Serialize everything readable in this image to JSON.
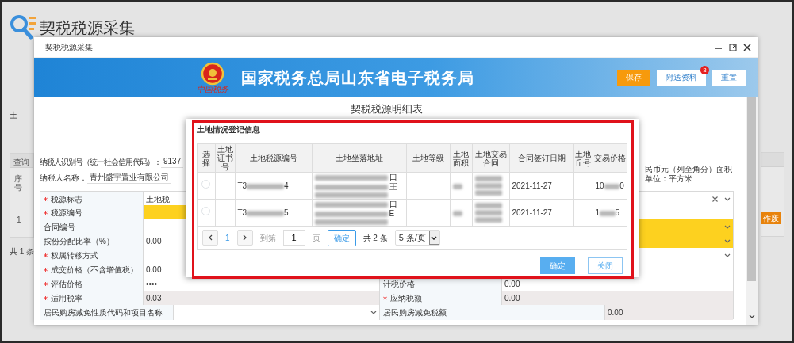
{
  "page": {
    "title": "契税税源采集",
    "left_label": "土",
    "results_title": "查询",
    "results_header": "序号",
    "results_row": "1",
    "total": "共 1 条",
    "void_button": "作废"
  },
  "window": {
    "title": "契税税源采集",
    "banner_title": "国家税务总局山东省电子税务局",
    "logo_caption": "中国税务",
    "buttons": [
      {
        "label": "保存",
        "kind": "primary"
      },
      {
        "label": "附送资料",
        "kind": "plain",
        "badge": "3"
      },
      {
        "label": "重置",
        "kind": "plain"
      }
    ]
  },
  "form": {
    "title": "契税税源明细表",
    "taxpayer_id_label": "纳税人识别号（统一社会信用代码）：",
    "taxpayer_id": "9137",
    "taxpayer_name_label": "纳税人名称：",
    "taxpayer_name": "青州盛宇置业有限公司",
    "units_note": "民币元（列至角分）面积单位：平方米",
    "rows": [
      {
        "kind": "full",
        "label": "税源标志",
        "required": true,
        "field": {
          "value": "土地税",
          "kind": "select",
          "clearable": true,
          "highlighted": false,
          "readonly": false
        }
      },
      {
        "kind": "split",
        "label": "税源编号",
        "required": true,
        "field": {
          "kind": "text",
          "highlighted": true,
          "readonly": false
        },
        "field2": {
          "kind": "text",
          "highlighted": false,
          "readonly": false
        }
      },
      {
        "kind": "split",
        "label": "合同编号",
        "required": false,
        "field": {
          "kind": "text",
          "highlighted": false,
          "readonly": false
        },
        "field2": {
          "kind": "select",
          "highlighted": true,
          "readonly": false
        }
      },
      {
        "kind": "split",
        "label": "按份分配比率（%）",
        "required": false,
        "field": {
          "value": "0.00",
          "kind": "text",
          "highlighted": false,
          "readonly": false
        },
        "field2": {
          "kind": "select",
          "highlighted": true,
          "readonly": false
        }
      },
      {
        "kind": "full",
        "label": "权属转移方式",
        "required": true,
        "field": {
          "kind": "select",
          "highlighted": false,
          "readonly": false
        }
      },
      {
        "kind": "full",
        "label": "成交价格（不含增值税）",
        "required": true,
        "field": {
          "value": "0.00",
          "kind": "text",
          "highlighted": false,
          "readonly": false
        }
      },
      {
        "kind": "split",
        "label": "评估价格",
        "required": true,
        "field": {
          "value": "••••",
          "kind": "text",
          "highlighted": false,
          "readonly": false
        },
        "label2": "计税价格",
        "required2": false,
        "field2": {
          "value": "0.00",
          "kind": "text",
          "highlighted": false,
          "readonly": false
        }
      },
      {
        "kind": "split",
        "label": "适用税率",
        "required": true,
        "field": {
          "value": "0.03",
          "kind": "text",
          "highlighted": false,
          "readonly": true
        },
        "label2": "应纳税额",
        "required2": true,
        "field2": {
          "value": "0.00",
          "kind": "text",
          "highlighted": false,
          "readonly": true
        }
      },
      {
        "kind": "wide",
        "label": "居民购房减免性质代码和项目名称",
        "required": false,
        "field": {
          "kind": "select",
          "highlighted": false,
          "readonly": false
        },
        "label2": "居民购房减免税额",
        "required2": false,
        "field2": {
          "value": "0.00",
          "kind": "text",
          "highlighted": false,
          "readonly": true
        }
      }
    ]
  },
  "dialog": {
    "title": "土地情况登记信息",
    "columns": [
      "选择",
      "土地证书号",
      "土地税源编号",
      "土地坐落地址",
      "土地等级",
      "土地面积",
      "土地交易合同",
      "合同签订日期",
      "土地丘号",
      "交易价格"
    ],
    "rows": [
      {
        "selected": false,
        "cells": [
          {
            "kind": "radio"
          },
          {
            "kind": "blank"
          },
          {
            "kind": "masked",
            "start": "T3",
            "end": "4"
          },
          {
            "kind": "masked_lines",
            "line_ends": [
              "口",
              "王"
            ]
          },
          {
            "kind": "blank"
          },
          {
            "kind": "masked"
          },
          {
            "kind": "masked_lines"
          },
          {
            "kind": "text",
            "text": "2021-11-27"
          },
          {
            "kind": "blank"
          },
          {
            "kind": "masked",
            "start": "10",
            "end": "0"
          }
        ]
      },
      {
        "selected": false,
        "cells": [
          {
            "kind": "radio"
          },
          {
            "kind": "blank"
          },
          {
            "kind": "masked",
            "start": "T3",
            "end": "5"
          },
          {
            "kind": "masked_lines",
            "line_ends": [
              "口",
              "E"
            ]
          },
          {
            "kind": "blank"
          },
          {
            "kind": "masked"
          },
          {
            "kind": "masked_lines"
          },
          {
            "kind": "text",
            "text": "2021-11-27"
          },
          {
            "kind": "blank"
          },
          {
            "kind": "masked",
            "start": "1",
            "end": "5"
          }
        ]
      }
    ],
    "pager": {
      "page": "1",
      "goto_label": "到第",
      "goto_value": "1",
      "page_unit": "页",
      "go_button": "确定",
      "total": "共 2 条",
      "page_size": "5 条/页"
    },
    "buttons": [
      {
        "label": "确定",
        "kind": "primary"
      },
      {
        "label": "关闭",
        "kind": "outline"
      }
    ]
  }
}
